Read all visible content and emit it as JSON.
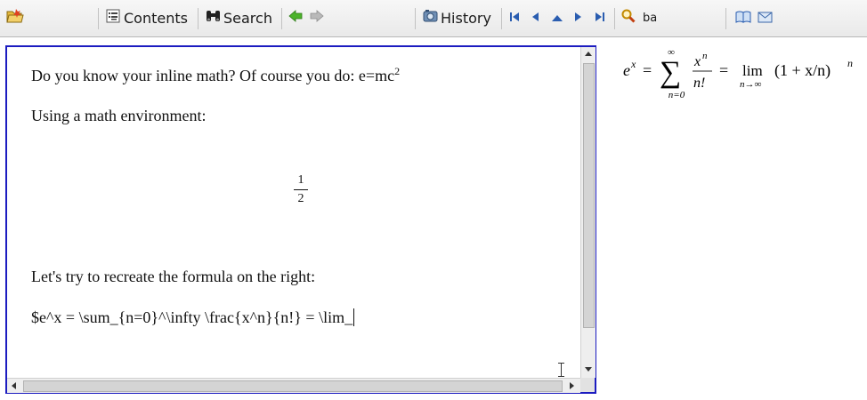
{
  "toolbar": {
    "contents_label": "Contents",
    "search_label": "Search",
    "history_label": "History",
    "format_label": "ba"
  },
  "editor": {
    "line1_text": "Do you know your inline math? Of course you do: e=mc",
    "line1_sup": "2",
    "line2_text": "Using a math environment:",
    "frac_num": "1",
    "frac_den": "2",
    "line3_text": "Let's try to recreate the formula on the right:",
    "line4_text": "$e^x = \\sum_{n=0}^\\infty \\frac{x^n}{n!} = \\lim_"
  },
  "preview": {
    "e": "e",
    "x": "x",
    "eq1": "=",
    "sum": "∑",
    "sum_top": "∞",
    "sum_bottom": "n=0",
    "frac_num": "x",
    "frac_num_sup": "n",
    "frac_den": "n!",
    "eq2": "=",
    "lim": "lim",
    "lim_sub": "n→∞",
    "paren_expr": "(1 + x/n)",
    "paren_sup": "n"
  }
}
